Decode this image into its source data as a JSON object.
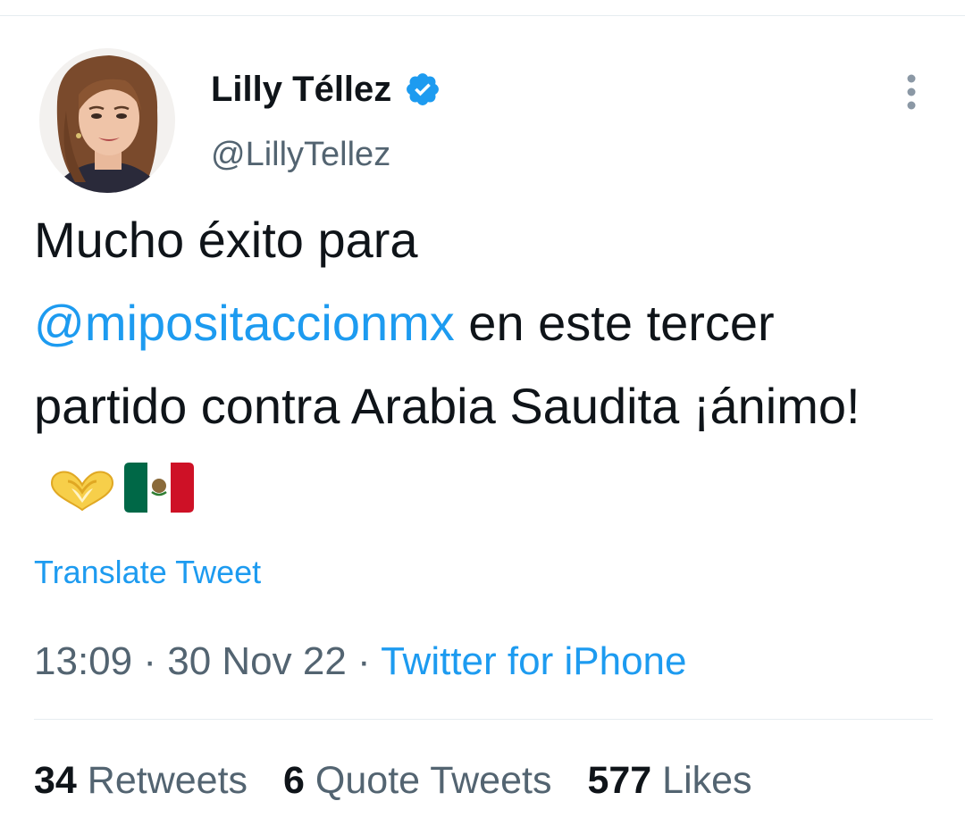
{
  "author": {
    "name": "Lilly Téllez",
    "handle": "@LillyTellez",
    "verified": true,
    "avatar_icon": "profile-photo",
    "verified_icon": "verified-badge-icon"
  },
  "tweet": {
    "text_before": "Mucho éxito para ",
    "mention": "@mipositaccionmx",
    "text_after": " en este tercer partido contra Arabia Saudita ¡ánimo!",
    "emojis": [
      "heart-hands-emoji",
      "mexico-flag-emoji"
    ]
  },
  "translate_label": "Translate Tweet",
  "meta": {
    "time": "13:09",
    "separator": " · ",
    "date": "30 Nov 22",
    "source": "Twitter for iPhone"
  },
  "stats": {
    "retweets_count": "34",
    "retweets_label": "Retweets",
    "quotes_count": "6",
    "quotes_label": "Quote Tweets",
    "likes_count": "577",
    "likes_label": "Likes"
  },
  "colors": {
    "accent": "#1d9bf0",
    "text_primary": "#0f1419",
    "text_secondary": "#536471",
    "divider": "#e6ecf0"
  }
}
